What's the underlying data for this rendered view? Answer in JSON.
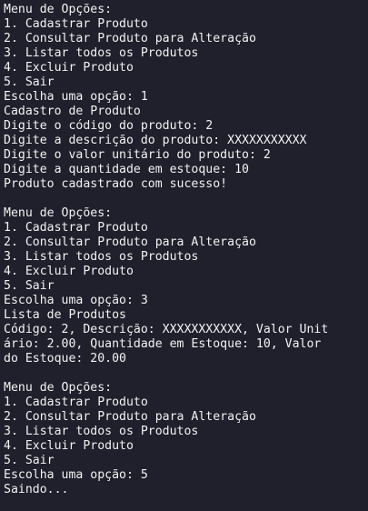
{
  "terminal": {
    "lines": [
      "Menu de Opções:",
      "1. Cadastrar Produto",
      "2. Consultar Produto para Alteração",
      "3. Listar todos os Produtos",
      "4. Excluir Produto",
      "5. Sair",
      "Escolha uma opção: 1",
      "Cadastro de Produto",
      "Digite o código do produto: 2",
      "Digite a descrição do produto: XXXXXXXXXXX",
      "Digite o valor unitário do produto: 2",
      "Digite a quantidade em estoque: 10",
      "Produto cadastrado com sucesso!",
      "",
      "Menu de Opções:",
      "1. Cadastrar Produto",
      "2. Consultar Produto para Alteração",
      "3. Listar todos os Produtos",
      "4. Excluir Produto",
      "5. Sair",
      "Escolha uma opção: 3",
      "Lista de Produtos",
      "Código: 2, Descrição: XXXXXXXXXXX, Valor Unit",
      "ário: 2.00, Quantidade em Estoque: 10, Valor",
      "do Estoque: 20.00",
      "",
      "Menu de Opções:",
      "1. Cadastrar Produto",
      "2. Consultar Produto para Alteração",
      "3. Listar todos os Produtos",
      "4. Excluir Produto",
      "5. Sair",
      "Escolha uma opção: 5",
      "Saindo..."
    ]
  }
}
